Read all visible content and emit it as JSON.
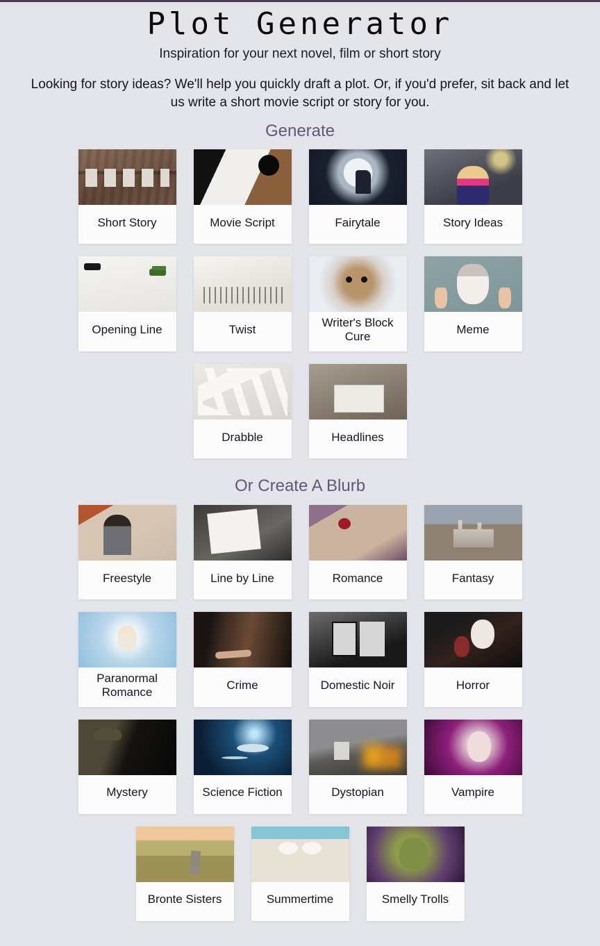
{
  "site": {
    "title": "Plot Generator",
    "tagline": "Inspiration for your next novel, film or short story",
    "intro": "Looking for story ideas? We'll help you quickly draft a plot. Or, if you'd prefer, sit back and let us write a short movie script or story for you."
  },
  "theme": {
    "background": "#e3e5ea",
    "top_strip": "#4a3c55",
    "heading_color": "#5f5878",
    "card_background": "#fcfcfd",
    "label_color": "#15151f"
  },
  "sections": [
    {
      "heading": "Generate",
      "rows": [
        [
          {
            "label": "Short Story",
            "thumb": "story-letters-on-clothesline-image"
          },
          {
            "label": "Movie Script",
            "thumb": "clapperboard-and-script-image"
          },
          {
            "label": "Fairytale",
            "thumb": "child-reading-on-moon-image"
          },
          {
            "label": "Story Ideas",
            "thumb": "woman-with-lightbulb-idea-image"
          }
        ],
        [
          {
            "label": "Opening Line",
            "thumb": "desk-with-glasses-and-pencil-image"
          },
          {
            "label": "Twist",
            "thumb": "crumpling-paper-over-notebook-image"
          },
          {
            "label": "Writer's Block Cure",
            "thumb": "surprised-cat-image"
          },
          {
            "label": "Meme",
            "thumb": "cat-with-pointing-fingers-image"
          }
        ],
        [
          {
            "label": "Drabble",
            "thumb": "scattered-word-tiles-image"
          },
          {
            "label": "Headlines",
            "thumb": "man-shouting-with-newspaper-image"
          }
        ]
      ]
    },
    {
      "heading": "Or Create A Blurb",
      "rows": [
        [
          {
            "label": "Freestyle",
            "thumb": "woman-writing-on-sofa-image"
          },
          {
            "label": "Line by Line",
            "thumb": "once-upon-a-time-tiles-image"
          },
          {
            "label": "Romance",
            "thumb": "rose-on-open-book-image"
          },
          {
            "label": "Fantasy",
            "thumb": "fairytale-castle-image"
          }
        ],
        [
          {
            "label": "Paranormal Romance",
            "thumb": "ghostly-woman-in-clouds-image"
          },
          {
            "label": "Crime",
            "thumb": "body-in-dark-alley-image"
          },
          {
            "label": "Domestic Noir",
            "thumb": "derelict-windows-image"
          },
          {
            "label": "Horror",
            "thumb": "clown-with-axe-image"
          }
        ],
        [
          {
            "label": "Mystery",
            "thumb": "detective-with-magnifier-image"
          },
          {
            "label": "Science Fiction",
            "thumb": "ufos-over-landscape-image"
          },
          {
            "label": "Dystopian",
            "thumb": "storm-over-burning-ruins-image"
          },
          {
            "label": "Vampire",
            "thumb": "purple-haired-vampire-woman-image"
          }
        ],
        [
          {
            "label": "Bronte Sisters",
            "thumb": "moorland-standing-stone-image"
          },
          {
            "label": "Summertime",
            "thumb": "two-women-on-beach-image"
          },
          {
            "label": "Smelly Trolls",
            "thumb": "green-troll-image"
          }
        ]
      ]
    }
  ]
}
